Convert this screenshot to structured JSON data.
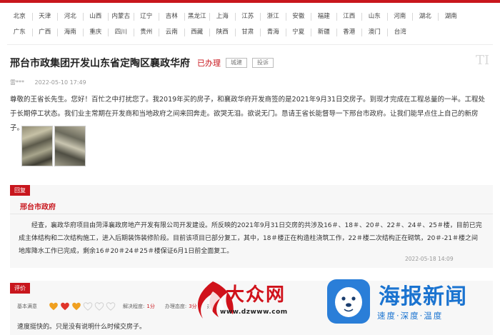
{
  "regions": {
    "row1": [
      "北京",
      "天津",
      "河北",
      "山西",
      "内蒙古",
      "辽宁",
      "吉林",
      "黑龙江",
      "上海",
      "江苏",
      "浙江",
      "安徽",
      "福建",
      "江西",
      "山东",
      "河南",
      "湖北",
      "湖南"
    ],
    "row2": [
      "广东",
      "广西",
      "海南",
      "重庆",
      "四川",
      "贵州",
      "云南",
      "西藏",
      "陕西",
      "甘肃",
      "青海",
      "宁夏",
      "新疆",
      "香港",
      "澳门",
      "台湾"
    ]
  },
  "post": {
    "title": "邢台市政集团开发山东省定陶区襄政华府",
    "status": "已办理",
    "tags": [
      "城建",
      "投诉"
    ],
    "author": "雷***",
    "time": "2022-05-10 17:49",
    "body": "尊敬的王省长先生。您好！百忙之中打扰您了。我2019年买的房子，和襄政华府开发商签的是2021年9月31日交房子。到现才完成在工程总量的一半。工程处于长期停工状态。我们业主常期在开发商和当地政府之间来回奔走。欲哭无泪。欲说无门。恳请王省长能督导一下邢台市政府。让我们能早点住上自己的新房子。",
    "photos": [
      "construction-photo",
      "construction-photo"
    ]
  },
  "reply": {
    "label": "回复",
    "org": "邢台市政府",
    "text": "经查，襄政华府项目由菏泽襄政房地产开发有限公司开发建设。所反映的2021年9月31日交房的共涉及16＃、18＃、20＃、22＃、24＃、25＃楼，目前已完成主体结构和二次结构施工，进入后期装饰装修阶段。目前该项目已部分复工，其中，18＃楼正在构造柱浇筑工作，22＃楼二次结构正在砌筑，20＃-21＃楼之间地库降水工作已完成，剩余16＃20＃24＃25＃楼保证6月1日前全面复工。",
    "time": "2022-05-18 14:09"
  },
  "evaluation": {
    "label": "评价",
    "basic_label": "基本满意",
    "hearts_filled": 3,
    "hearts_total": 6,
    "fields": [
      {
        "name": "解决程度:",
        "value": "1分"
      },
      {
        "name": "办理态度:",
        "value": "3分"
      },
      {
        "name": "办理",
        "value": ""
      }
    ],
    "comment": "速度挺快的。只是没有说明什么时候交房子。"
  },
  "corner_mark": "TI",
  "watermarks": {
    "dazhong_name": "大众网",
    "dazhong_url": "www.dzwww.com",
    "haibao_name": "海报新闻",
    "haibao_slogan": "速度·深度·温度"
  },
  "colors": {
    "accent": "#c8161d",
    "brand_blue": "#1a73d0"
  }
}
